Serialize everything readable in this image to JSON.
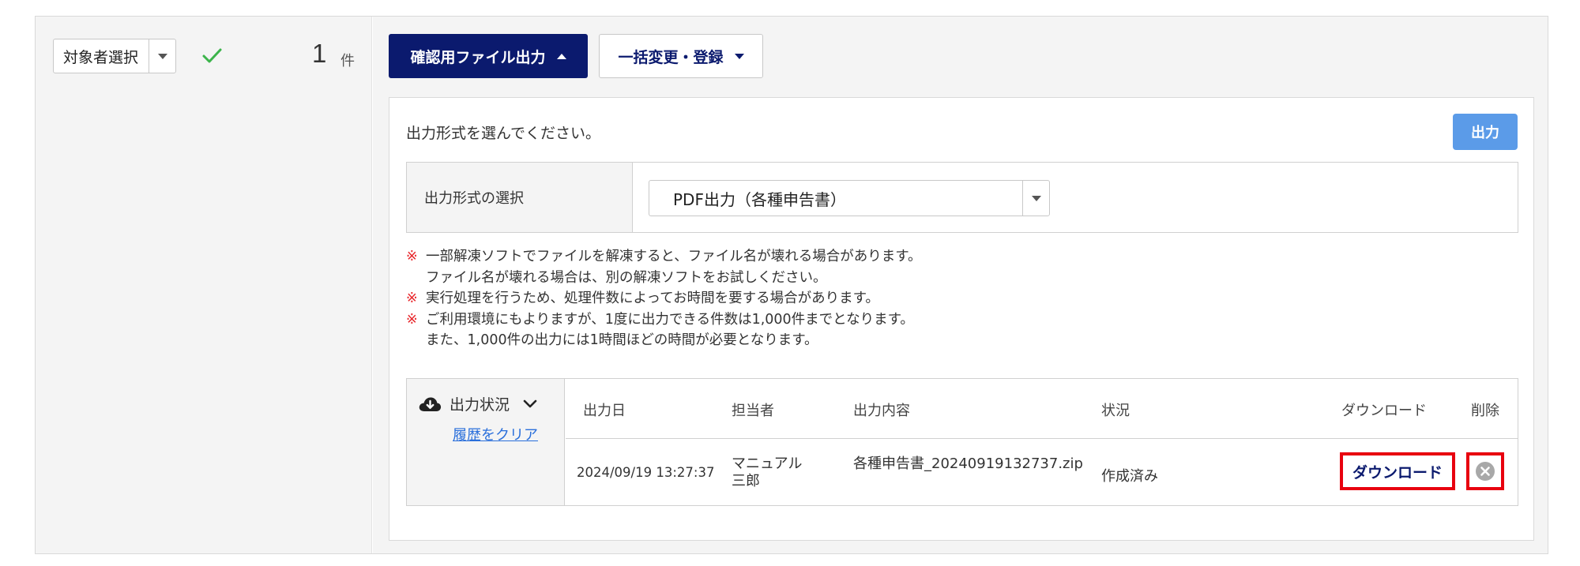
{
  "left": {
    "target_select_label": "対象者選択",
    "count": "1",
    "count_unit": "件",
    "check_color": "#3cb44b"
  },
  "toolbar": {
    "confirm_file_output": "確認用ファイル出力",
    "bulk_change_register": "一括変更・登録"
  },
  "output_panel": {
    "prompt": "出力形式を選んでください。",
    "output_button": "出力",
    "format_label": "出力形式の選択",
    "format_selected": "PDF出力（各種申告書）"
  },
  "notes": {
    "mark": "※",
    "items": [
      [
        "一部解凍ソフトでファイルを解凍すると、ファイル名が壊れる場合があります。",
        "ファイル名が壊れる場合は、別の解凍ソフトをお試しください。"
      ],
      [
        "実行処理を行うため、処理件数によってお時間を要する場合があります。"
      ],
      [
        "ご利用環境にもよりますが、1度に出力できる件数は1,000件までとなります。",
        "また、1,000件の出力には1時間ほどの時間が必要となります。"
      ]
    ]
  },
  "history": {
    "title": "出力状況",
    "clear_link": "履歴をクリア",
    "columns": {
      "date": "出力日",
      "person": "担当者",
      "content": "出力内容",
      "status": "状況",
      "download": "ダウンロード",
      "delete": "削除"
    },
    "rows": [
      {
        "date": "2024/09/19 13:27:37",
        "person": "マニュアル　三郎",
        "content": "各種申告書_20240919132737.zip",
        "status": "作成済み",
        "download": "ダウンロード"
      }
    ]
  },
  "colors": {
    "primary_navy": "#0b1a6e",
    "output_button_blue": "#5b9be8",
    "note_mark_red": "#e8262b",
    "highlight_red": "#e8000f",
    "link_blue": "#2a6fdb"
  },
  "icons": {
    "check": "check-icon",
    "cloud": "cloud-download-icon",
    "chevron": "chevron-down-icon",
    "delete": "close-circle-icon"
  }
}
